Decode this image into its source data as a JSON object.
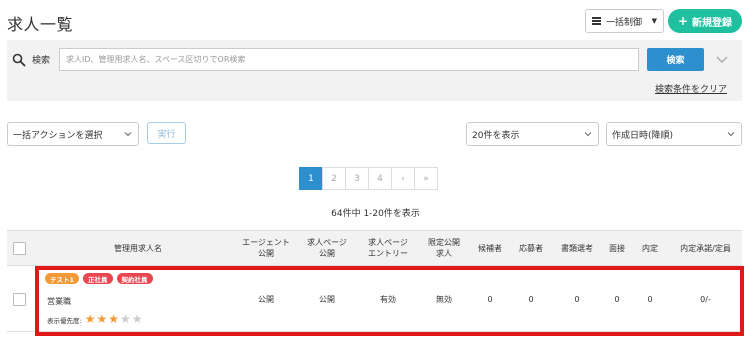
{
  "header": {
    "title": "求人一覧",
    "bulk_control_label": "一括制御",
    "new_button_label": "新規登録"
  },
  "search": {
    "label": "検索",
    "placeholder": "求人ID、管理用求人名、スペース区切りでOR検索",
    "button_label": "検索",
    "clear_label": "検索条件をクリア"
  },
  "actions": {
    "bulk_select": "一括アクションを選択",
    "execute_label": "実行",
    "per_page": "20件を表示",
    "sort": "作成日時(降順)"
  },
  "pagination": {
    "pages": [
      "1",
      "2",
      "3",
      "4",
      "›",
      "»"
    ],
    "current": "1",
    "summary": "64件中 1-20件を表示"
  },
  "table": {
    "headers": {
      "name": "管理用求人名",
      "agent": "エージェント\n公開",
      "page": "求人ページ\n公開",
      "entry": "求人ページ\nエントリー",
      "limited": "限定公開\n求人",
      "candidates": "候補者",
      "applicants": "応募者",
      "screening": "書類選考",
      "interview": "面接",
      "offer": "内定",
      "acceptance": "内定承諾/定員"
    },
    "rows": [
      {
        "tags": [
          {
            "label": "テスト1",
            "color": "#f29a38"
          },
          {
            "label": "正社員",
            "color": "#e8474f"
          },
          {
            "label": "契約社員",
            "color": "#e8474f"
          }
        ],
        "name": "営業職",
        "priority_label": "表示優先度:",
        "priority": 3,
        "priority_max": 5,
        "agent": "公開",
        "page": "公開",
        "entry": "有効",
        "limited": "無効",
        "candidates": "0",
        "applicants": "0",
        "screening": "0",
        "interview": "0",
        "offer": "0",
        "acceptance": "0/-"
      }
    ]
  },
  "colors": {
    "accent_green": "#1ec0a0",
    "accent_blue": "#2d8fcd",
    "star_on": "#f29a38",
    "star_off": "#cccccc",
    "highlight": "#e01818"
  }
}
